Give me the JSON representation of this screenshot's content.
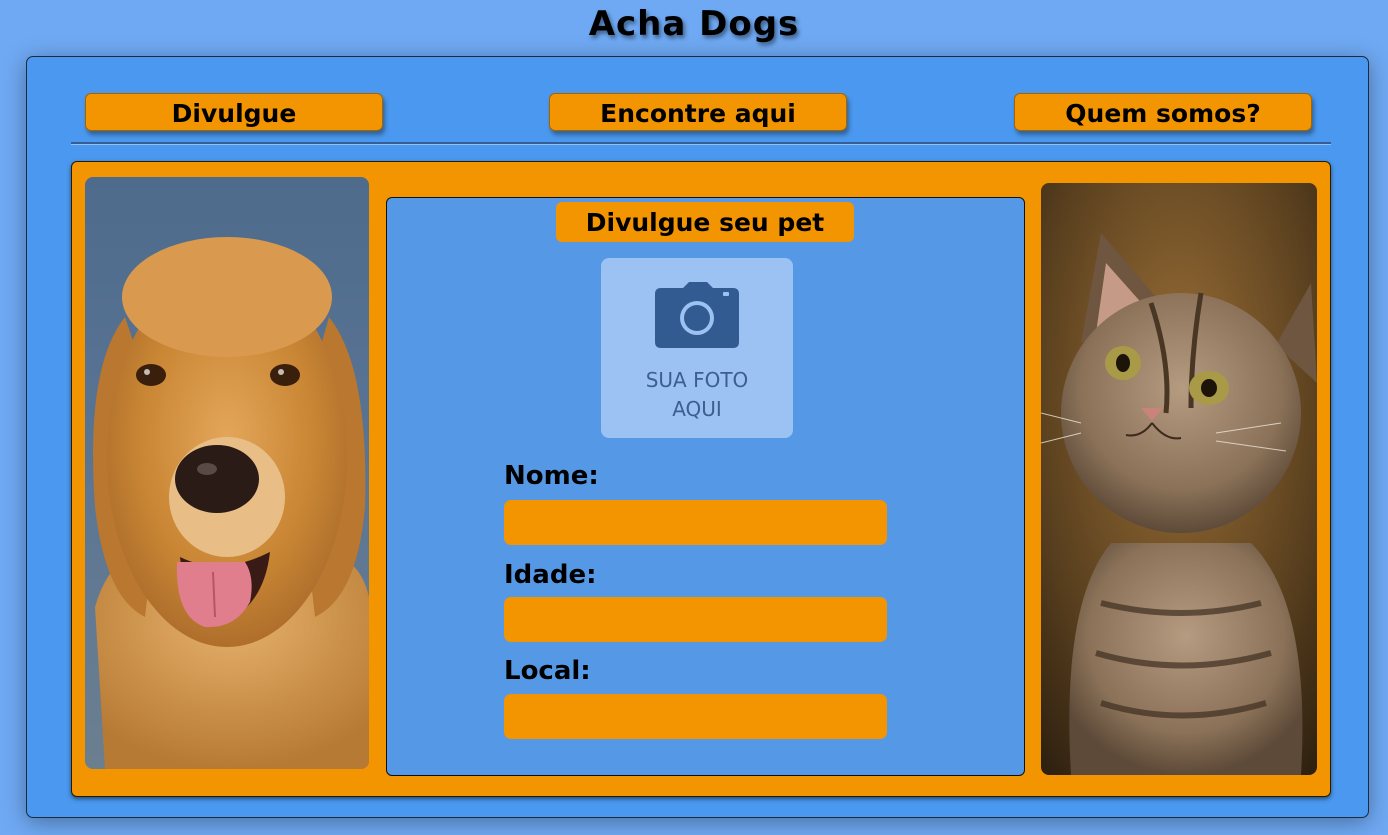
{
  "header": {
    "title": "Acha Dogs"
  },
  "nav": {
    "divulgue": "Divulgue",
    "encontre": "Encontre aqui",
    "quem_somos": "Quem somos?"
  },
  "form": {
    "heading": "Divulgue seu pet",
    "photo_placeholder": "SUA FOTO\nAQUI",
    "fields": [
      {
        "label": "Nome:",
        "value": ""
      },
      {
        "label": "Idade:",
        "value": ""
      },
      {
        "label": "Local:",
        "value": ""
      }
    ]
  },
  "images": {
    "left": "dog-photo",
    "right": "cat-photo"
  },
  "colors": {
    "page_bg": "#6fa9f3",
    "frame_bg": "#4a98ef",
    "accent_orange": "#f39500",
    "card_blue": "#5599e6"
  }
}
